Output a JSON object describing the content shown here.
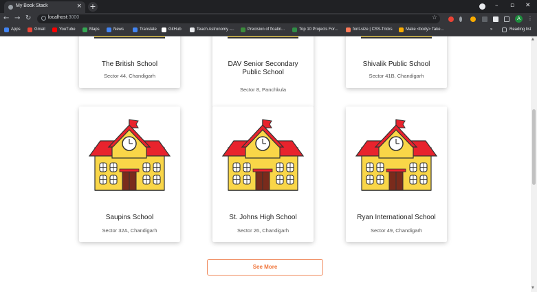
{
  "browser": {
    "tab_title": "My Book Stack",
    "tab_close": "×",
    "new_tab": "+",
    "url_host": "localhost",
    "url_port": ":3000",
    "profile_initial": "A",
    "bookmarks": [
      {
        "label": "Apps",
        "icon": "apps-grid-icon",
        "color": "#4285f4"
      },
      {
        "label": "Gmail",
        "icon": "gmail-icon",
        "color": "#ea4335"
      },
      {
        "label": "YouTube",
        "icon": "youtube-icon",
        "color": "#ff0000"
      },
      {
        "label": "Maps",
        "icon": "maps-icon",
        "color": "#34a853"
      },
      {
        "label": "News",
        "icon": "news-icon",
        "color": "#4285f4"
      },
      {
        "label": "Translate",
        "icon": "translate-icon",
        "color": "#4285f4"
      },
      {
        "label": "GitHub",
        "icon": "github-icon",
        "color": "#ffffff"
      },
      {
        "label": "Teach Astronomy -...",
        "icon": "astronomy-icon",
        "color": "#e8eaed"
      },
      {
        "label": "Precision of floatin...",
        "icon": "stackoverflow-icon",
        "color": "#3c8c3c"
      },
      {
        "label": "Top 10 Projects For...",
        "icon": "geeks-icon",
        "color": "#2f8d46"
      },
      {
        "label": "font-size | CSS-Tricks",
        "icon": "csstricks-icon",
        "color": "#ff7a59"
      },
      {
        "label": "Make <body> Take...",
        "icon": "blog-icon",
        "color": "#f9ab00"
      }
    ],
    "reading_list": "Reading list",
    "more_bookmarks": "»"
  },
  "schools_top": [
    {
      "name": "The British School",
      "location": "Sector 44, Chandigarh"
    },
    {
      "name": "DAV Senior Secondary Public School",
      "location": "Sector 8, Panchkula"
    },
    {
      "name": "Shivalik Public School",
      "location": "Sector 41B, Chandigarh"
    }
  ],
  "schools_bottom": [
    {
      "name": "Saupins School",
      "location": "Sector 32A, Chandigarh"
    },
    {
      "name": "St. Johns High School",
      "location": "Sector 26, Chandigarh"
    },
    {
      "name": "Ryan International School",
      "location": "Sector 49, Chandigarh"
    }
  ],
  "see_more_label": "See More",
  "colors": {
    "accent": "#f0763c",
    "roof": "#e8232d",
    "wall": "#f9d648",
    "door": "#7a2b1c"
  }
}
